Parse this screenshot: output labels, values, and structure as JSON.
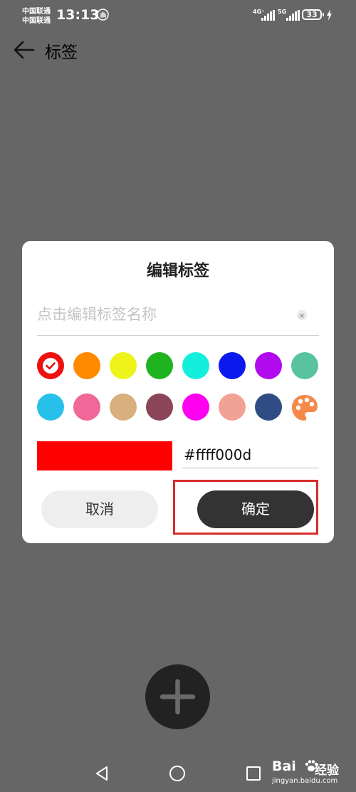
{
  "status_bar": {
    "carrier_1": "中国联通",
    "carrier_2": "中国联通",
    "time": "13:13",
    "signal_1_label": "4G⁺",
    "signal_2_label": "5G",
    "battery": "33"
  },
  "header": {
    "title": "标签"
  },
  "dialog": {
    "title": "编辑标签",
    "name_placeholder": "点击编辑标签名称",
    "name_value": "",
    "colors_row_1": [
      "#ee0f0f",
      "#ff8a00",
      "#eef31a",
      "#1fb31f",
      "#14eedc",
      "#0a1aef",
      "#b10aef",
      "#58c39e"
    ],
    "colors_row_2": [
      "#27c0ea",
      "#f06798",
      "#d8b07e",
      "#8a4558",
      "#ff00f0",
      "#f2a195",
      "#2f4c85"
    ],
    "selected_color": "#ff0000",
    "hex_value": "#ffff000d",
    "cancel_label": "取消",
    "confirm_label": "确定"
  },
  "watermark": {
    "logo": "Bai",
    "text": "经验",
    "domain": "jingyan.baidu.com"
  }
}
